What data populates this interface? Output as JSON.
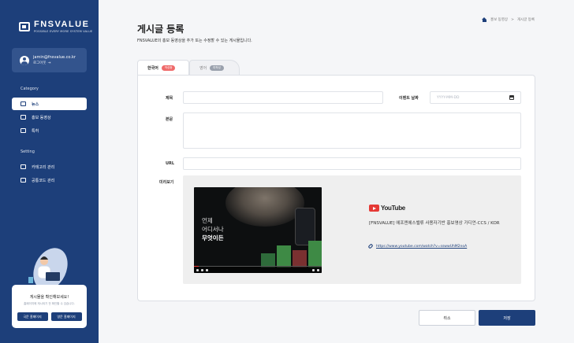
{
  "sidebar": {
    "logo_name": "FNSVALUE",
    "logo_tagline": "POSSIBLE EVERY MORE SYSTEM VALUE",
    "user_email": "jamin@fnsvalue.co.kr",
    "logout_label": "로그아웃",
    "category_heading": "Category",
    "category_items": [
      {
        "label": "뉴스",
        "active": true,
        "icon": "news-icon"
      },
      {
        "label": "홍보 동영상",
        "active": false,
        "icon": "video-icon"
      },
      {
        "label": "특허",
        "active": false,
        "icon": "patent-icon"
      }
    ],
    "setting_heading": "Setting",
    "setting_items": [
      {
        "label": "카테고리 관리",
        "icon": "category-icon"
      },
      {
        "label": "공통코드 관리",
        "icon": "code-icon"
      }
    ],
    "help_title": "게시물을 확인해보세요!",
    "help_subtitle": "홈페이지에 게시되기 전 확인할 수 있습니다.",
    "help_buttons": [
      "국문 홈페이지",
      "영문 홈페이지"
    ]
  },
  "header": {
    "title": "게시글 등록",
    "description": "FNSVALUE의 홍보 동영상을 추가 또는 수정할 수 있는 게시물입니다.",
    "breadcrumb": [
      "홍보 동영상",
      "게시글 등록"
    ]
  },
  "tabs": [
    {
      "label": "한국어",
      "badge": "작성중",
      "active": true
    },
    {
      "label": "영어",
      "badge": "미작성",
      "active": false
    }
  ],
  "form": {
    "title_label": "제목",
    "event_date_label": "이벤트 날짜",
    "event_date_placeholder": "YYYY-MM-DD",
    "body_label": "본문",
    "url_label": "URL",
    "preview_label": "미리보기"
  },
  "preview": {
    "video_overlay_lines": [
      "언제",
      "어디서나",
      "무엇이든"
    ],
    "youtube_wordmark": "YouTube",
    "video_title": "[FNSVALUE] 에프엔에스밸류 사용자기반 홍보영상 가디언-CCS / KOR",
    "video_url": "https://www.youtube.com/watch?v=sswwUhM2noA"
  },
  "actions": {
    "cancel_label": "취소",
    "save_label": "저장"
  },
  "colors": {
    "brand": "#1d3f7a",
    "badge_active": "#ef6a6a",
    "badge_inactive": "#9aa1ad",
    "youtube_red": "#e53935"
  }
}
